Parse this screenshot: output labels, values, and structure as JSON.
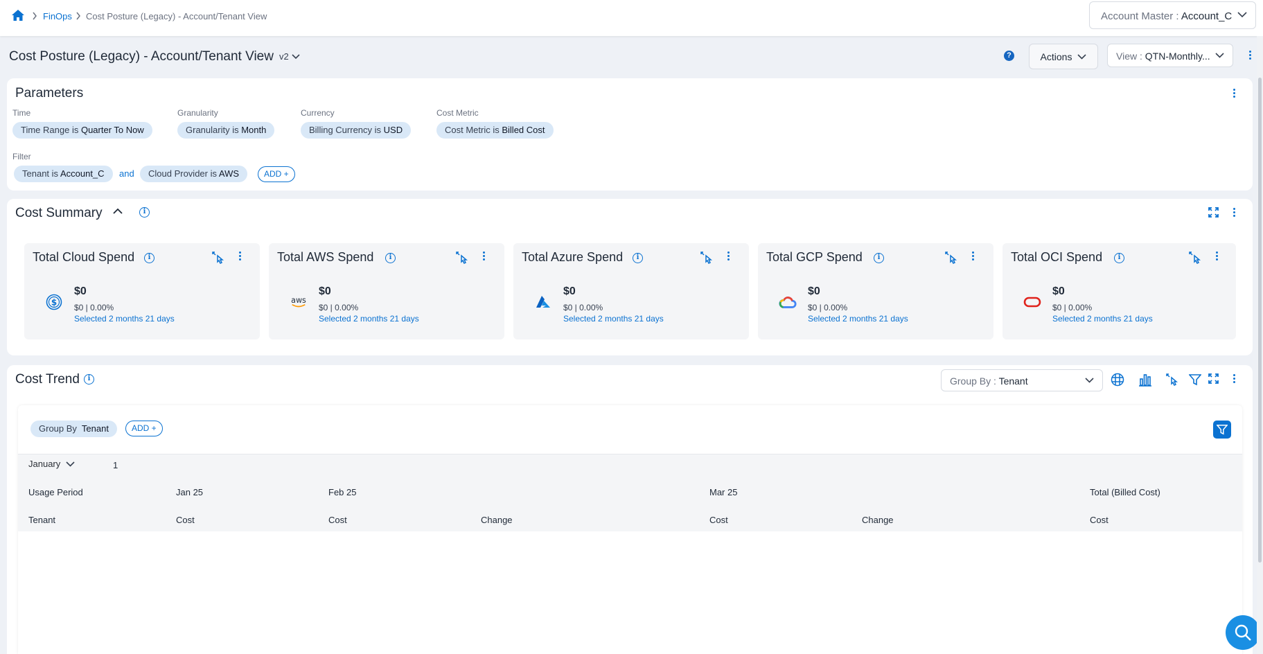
{
  "breadcrumb": {
    "home_icon": "home-icon",
    "finops": "FinOps",
    "current": "Cost Posture (Legacy) - Account/Tenant View"
  },
  "account": {
    "label": "Account Master :",
    "value": "Account_C"
  },
  "page": {
    "title": "Cost Posture (Legacy) - Account/Tenant View",
    "version": "v2",
    "help": "?",
    "actions_label": "Actions",
    "view_label": "View :",
    "view_value": "QTN-Monthly..."
  },
  "parameters": {
    "title": "Parameters",
    "time": {
      "label": "Time",
      "chip_prefix": "Time Range is",
      "chip_value": "Quarter To Now"
    },
    "granularity": {
      "label": "Granularity",
      "chip_prefix": "Granularity is",
      "chip_value": "Month"
    },
    "currency": {
      "label": "Currency",
      "chip_prefix": "Billing Currency is",
      "chip_value": "USD"
    },
    "metric": {
      "label": "Cost Metric",
      "chip_prefix": "Cost Metric is",
      "chip_value": "Billed Cost"
    },
    "filter": {
      "label": "Filter",
      "tenant_prefix": "Tenant is",
      "tenant_value": "Account_C",
      "and": "and",
      "provider_prefix": "Cloud Provider is",
      "provider_value": "AWS",
      "add": "ADD +"
    }
  },
  "summary": {
    "title": "Cost Summary",
    "cards": [
      {
        "title": "Total Cloud Spend",
        "icon": "dollar-icon",
        "amount": "$0",
        "sub": "$0 | 0.00%",
        "selected": "Selected 2 months 21 days"
      },
      {
        "title": "Total AWS Spend",
        "icon": "aws-logo",
        "amount": "$0",
        "sub": "$0 | 0.00%",
        "selected": "Selected 2 months 21 days"
      },
      {
        "title": "Total Azure Spend",
        "icon": "azure-logo",
        "amount": "$0",
        "sub": "$0 | 0.00%",
        "selected": "Selected 2 months 21 days"
      },
      {
        "title": "Total GCP Spend",
        "icon": "gcp-logo",
        "amount": "$0",
        "sub": "$0 | 0.00%",
        "selected": "Selected 2 months 21 days"
      },
      {
        "title": "Total OCI Spend",
        "icon": "oci-logo",
        "amount": "$0",
        "sub": "$0 | 0.00%",
        "selected": "Selected 2 months 21 days"
      }
    ]
  },
  "trend": {
    "title": "Cost Trend",
    "group_by_label": "Group By :",
    "group_by_value": "Tenant",
    "chip_label": "Group By",
    "chip_value": "Tenant",
    "add": "ADD +",
    "month": "January",
    "month_count": "1",
    "headers": {
      "usage_period": "Usage Period",
      "jan": "Jan 25",
      "feb": "Feb 25",
      "mar": "Mar 25",
      "total": "Total (Billed Cost)",
      "tenant": "Tenant",
      "cost1": "Cost",
      "cost2": "Cost",
      "change1": "Change",
      "cost3": "Cost",
      "change2": "Change",
      "cost4": "Cost"
    }
  }
}
